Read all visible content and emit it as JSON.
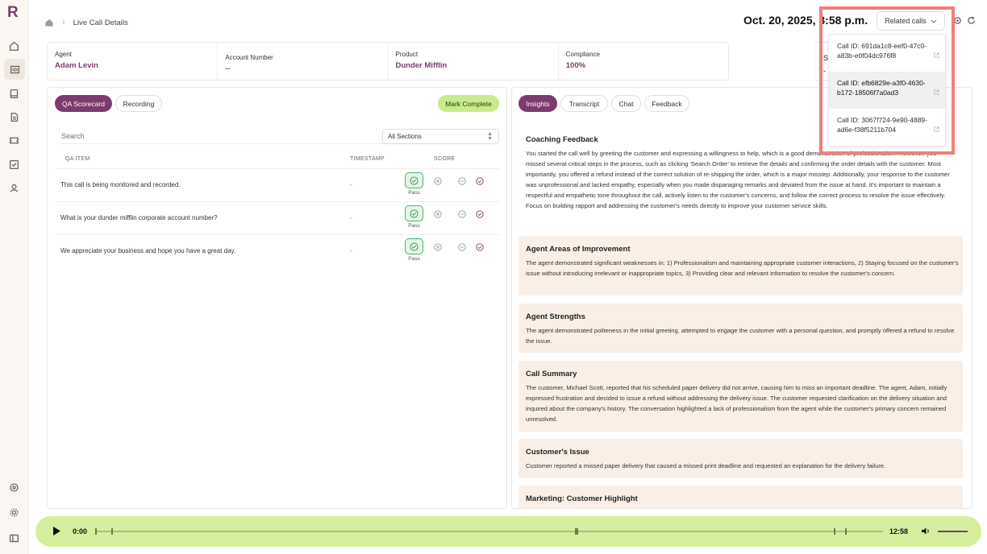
{
  "app": {
    "logo": "R"
  },
  "header": {
    "breadcrumb": "Live Call Details",
    "date": "Oct. 20, 2025, 3:58 p.m.",
    "related_calls_label": "Related calls"
  },
  "info": [
    {
      "label": "Agent",
      "value": "Adam Levin"
    },
    {
      "label": "Account Number",
      "value": "--"
    },
    {
      "label": "Product",
      "value": "Dunder Mifflin"
    },
    {
      "label": "Compliance",
      "value": "100%"
    }
  ],
  "info_extra": {
    "label": "S",
    "value": "-"
  },
  "left_tabs": {
    "qa_scorecard": "QA Scorecard",
    "recording": "Recording",
    "mark_complete": "Mark Complete"
  },
  "search": {
    "placeholder": "Search"
  },
  "sections_select": "All Sections",
  "table": {
    "headers": {
      "qa_item": "QA ITEM",
      "timestamp": "TIMESTAMP",
      "score": "SCORE"
    },
    "rows": [
      {
        "item": "This call is being monitored and recorded.",
        "timestamp": "-",
        "score": "Pass"
      },
      {
        "item": "What is your dunder mifflin corporate account number?",
        "timestamp": "-",
        "score": "Pass"
      },
      {
        "item": "We appreciate your business and hope you have a great day.",
        "timestamp": "-",
        "score": "Pass"
      }
    ]
  },
  "right_tabs": [
    "Insights",
    "Transcript",
    "Chat",
    "Feedback"
  ],
  "insights": {
    "coaching": {
      "title": "Coaching Feedback",
      "text": "You started the call well by greeting the customer and expressing a willingness to help, which is a good demonstration of professionalism. However, you missed several critical steps in the process, such as clicking 'Search Order' to retrieve the details and confirming the order details with the customer. Most importantly, you offered a refund instead of the correct solution of re-shipping the order, which is a major misstep. Additionally, your response to the customer was unprofessional and lacked empathy, especially when you made disparaging remarks and deviated from the issue at hand. It's important to maintain a respectful and empathetic tone throughout the call, actively listen to the customer's concerns, and follow the correct process to resolve the issue effectively. Focus on building rapport and addressing the customer's needs directly to improve your customer service skills."
    },
    "cards": [
      {
        "title": "Agent Areas of Improvement",
        "text": "The agent demonstrated significant weaknesses in: 1) Professionalism and maintaining appropriate customer interactions, 2) Staying focused on the customer's issue without introducing irrelevant or inappropriate topics, 3) Providing clear and relevant information to resolve the customer's concern."
      },
      {
        "title": "Agent Strengths",
        "text": "The agent demonstrated politeness in the initial greeting, attempted to engage the customer with a personal question, and promptly offered a refund to resolve the issue."
      },
      {
        "title": "Call Summary",
        "text": "The customer, Michael Scott, reported that his scheduled paper delivery did not arrive, causing him to miss an important deadline. The agent, Adam, initially expressed frustration and decided to issue a refund without addressing the delivery issue. The customer requested clarification on the delivery situation and inquired about the company's history. The conversation highlighted a lack of professionalism from the agent while the customer's primary concern remained unresolved."
      },
      {
        "title": "Customer's Issue",
        "text": "Customer reported a missed paper delivery that caused a missed print deadline and requested an explanation for the delivery failure."
      },
      {
        "title": "Marketing: Customer Highlight",
        "text": ""
      }
    ]
  },
  "related_calls": [
    "Call ID: 691da1c8-eef0-47c0-a83b-e0f04dc976f8",
    "Call ID: efb6829e-a3f0-4630-b172-18506f7a0ad3",
    "Call ID: 3067f724-9e90-4889-ad6e-f38f5211b704"
  ],
  "player": {
    "current": "0:00",
    "duration": "12:58",
    "progress": 0.0
  },
  "colors": {
    "brand": "#7b3b6e",
    "player_bg": "#d5ef9e",
    "pass_green": "#4fae74",
    "card_bg": "#f9efe6",
    "highlight": "#ef8078"
  },
  "icons": {
    "home": "home-icon",
    "gear": "gear-icon",
    "refresh": "refresh-icon",
    "play": "play-icon",
    "volume": "volume-icon"
  }
}
